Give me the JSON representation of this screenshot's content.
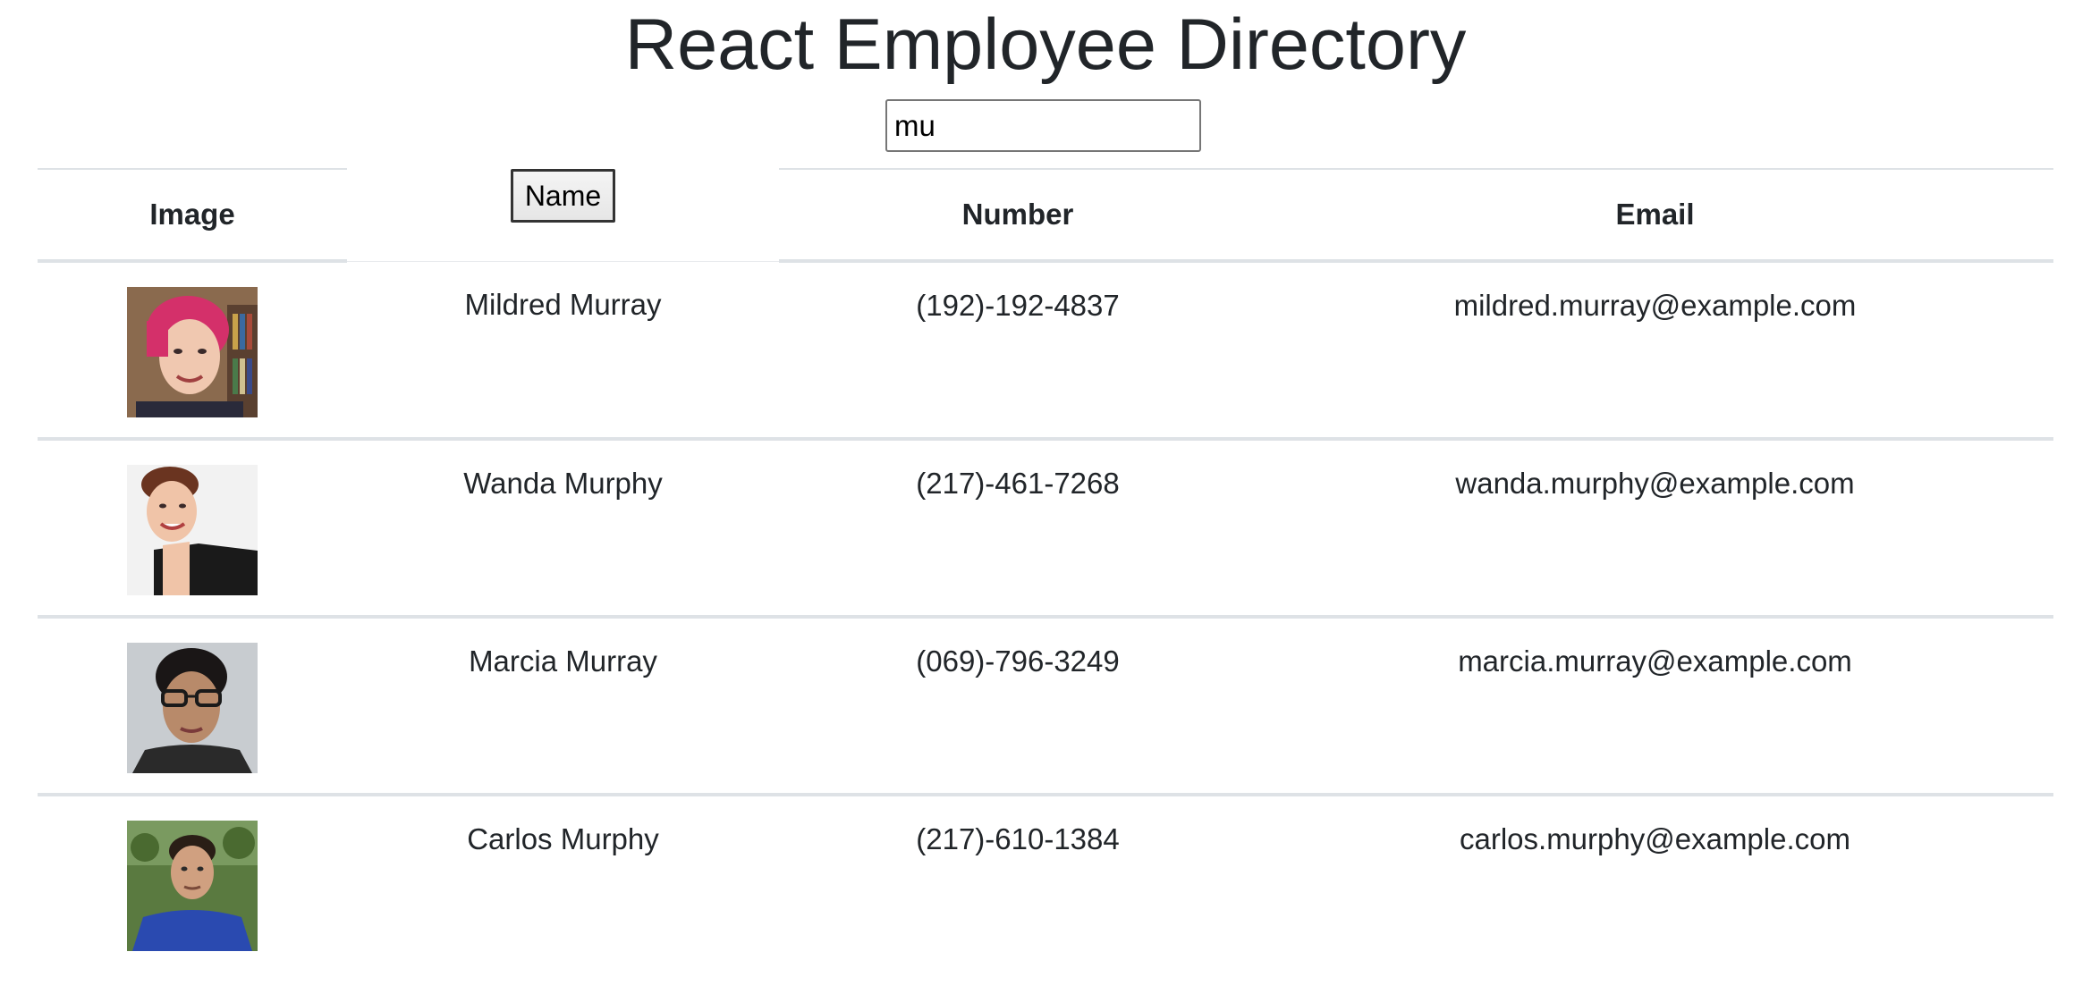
{
  "header": {
    "title": "React Employee Directory"
  },
  "search": {
    "value": "mu"
  },
  "table": {
    "columns": {
      "image": "Image",
      "name": "Name",
      "number": "Number",
      "email": "Email"
    },
    "rows": [
      {
        "name": "Mildred Murray",
        "number": "(192)-192-4837",
        "email": "mildred.murray@example.com",
        "avatar": "employee-photo"
      },
      {
        "name": "Wanda Murphy",
        "number": "(217)-461-7268",
        "email": "wanda.murphy@example.com",
        "avatar": "employee-photo"
      },
      {
        "name": "Marcia Murray",
        "number": "(069)-796-3249",
        "email": "marcia.murray@example.com",
        "avatar": "employee-photo"
      },
      {
        "name": "Carlos Murphy",
        "number": "(217)-610-1384",
        "email": "carlos.murphy@example.com",
        "avatar": "employee-photo"
      }
    ]
  }
}
